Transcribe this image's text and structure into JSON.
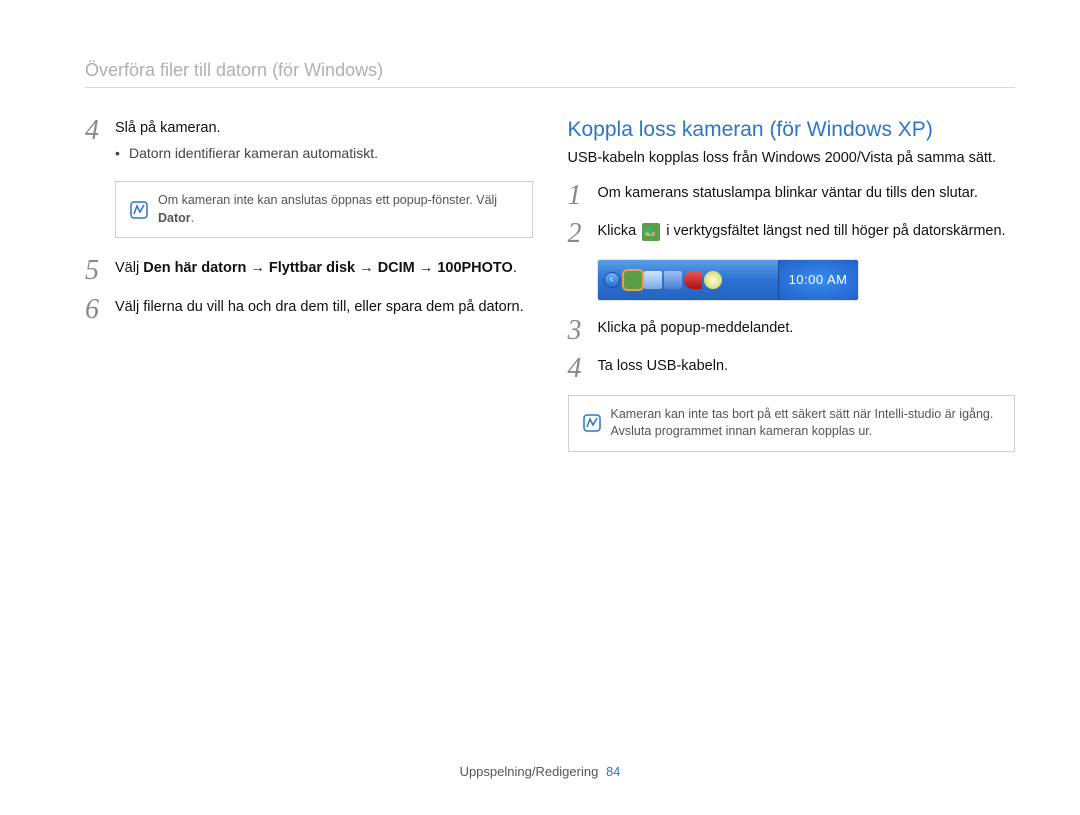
{
  "breadcrumb": "Överföra filer till datorn (för Windows)",
  "left": {
    "step4": {
      "num": "4",
      "text": "Slå på kameran.",
      "bullet": "Datorn identifierar kameran automatiskt."
    },
    "note4": {
      "prefix": "Om kameran inte kan anslutas öppnas ett popup-fönster. Välj ",
      "bold": "Dator",
      "suffix": "."
    },
    "step5": {
      "num": "5",
      "prefix": "Välj ",
      "p1": "Den här datorn",
      "p2": "Flyttbar disk",
      "p3": "DCIM",
      "p4": "100PHOTO",
      "arrow": " → ",
      "suffix": "."
    },
    "step6": {
      "num": "6",
      "text": "Välj filerna du vill ha och dra dem till, eller spara dem på datorn."
    }
  },
  "right": {
    "title": "Koppla loss kameran (för Windows XP)",
    "lead": "USB-kabeln kopplas loss från Windows 2000/Vista på samma sätt.",
    "step1": {
      "num": "1",
      "text": "Om kamerans statuslampa blinkar väntar du tills den slutar."
    },
    "step2": {
      "num": "2",
      "part1": "Klicka ",
      "part2": " i verktygsfältet längst ned till höger på datorskärmen."
    },
    "taskbar_time": "10:00 AM",
    "step3": {
      "num": "3",
      "text": "Klicka på popup-meddelandet."
    },
    "step4": {
      "num": "4",
      "text": "Ta loss USB-kabeln."
    },
    "note": "Kameran kan inte tas bort på ett säkert sätt när Intelli-studio är igång. Avsluta programmet innan kameran kopplas ur."
  },
  "footer": {
    "section": "Uppspelning/Redigering",
    "page": "84"
  }
}
